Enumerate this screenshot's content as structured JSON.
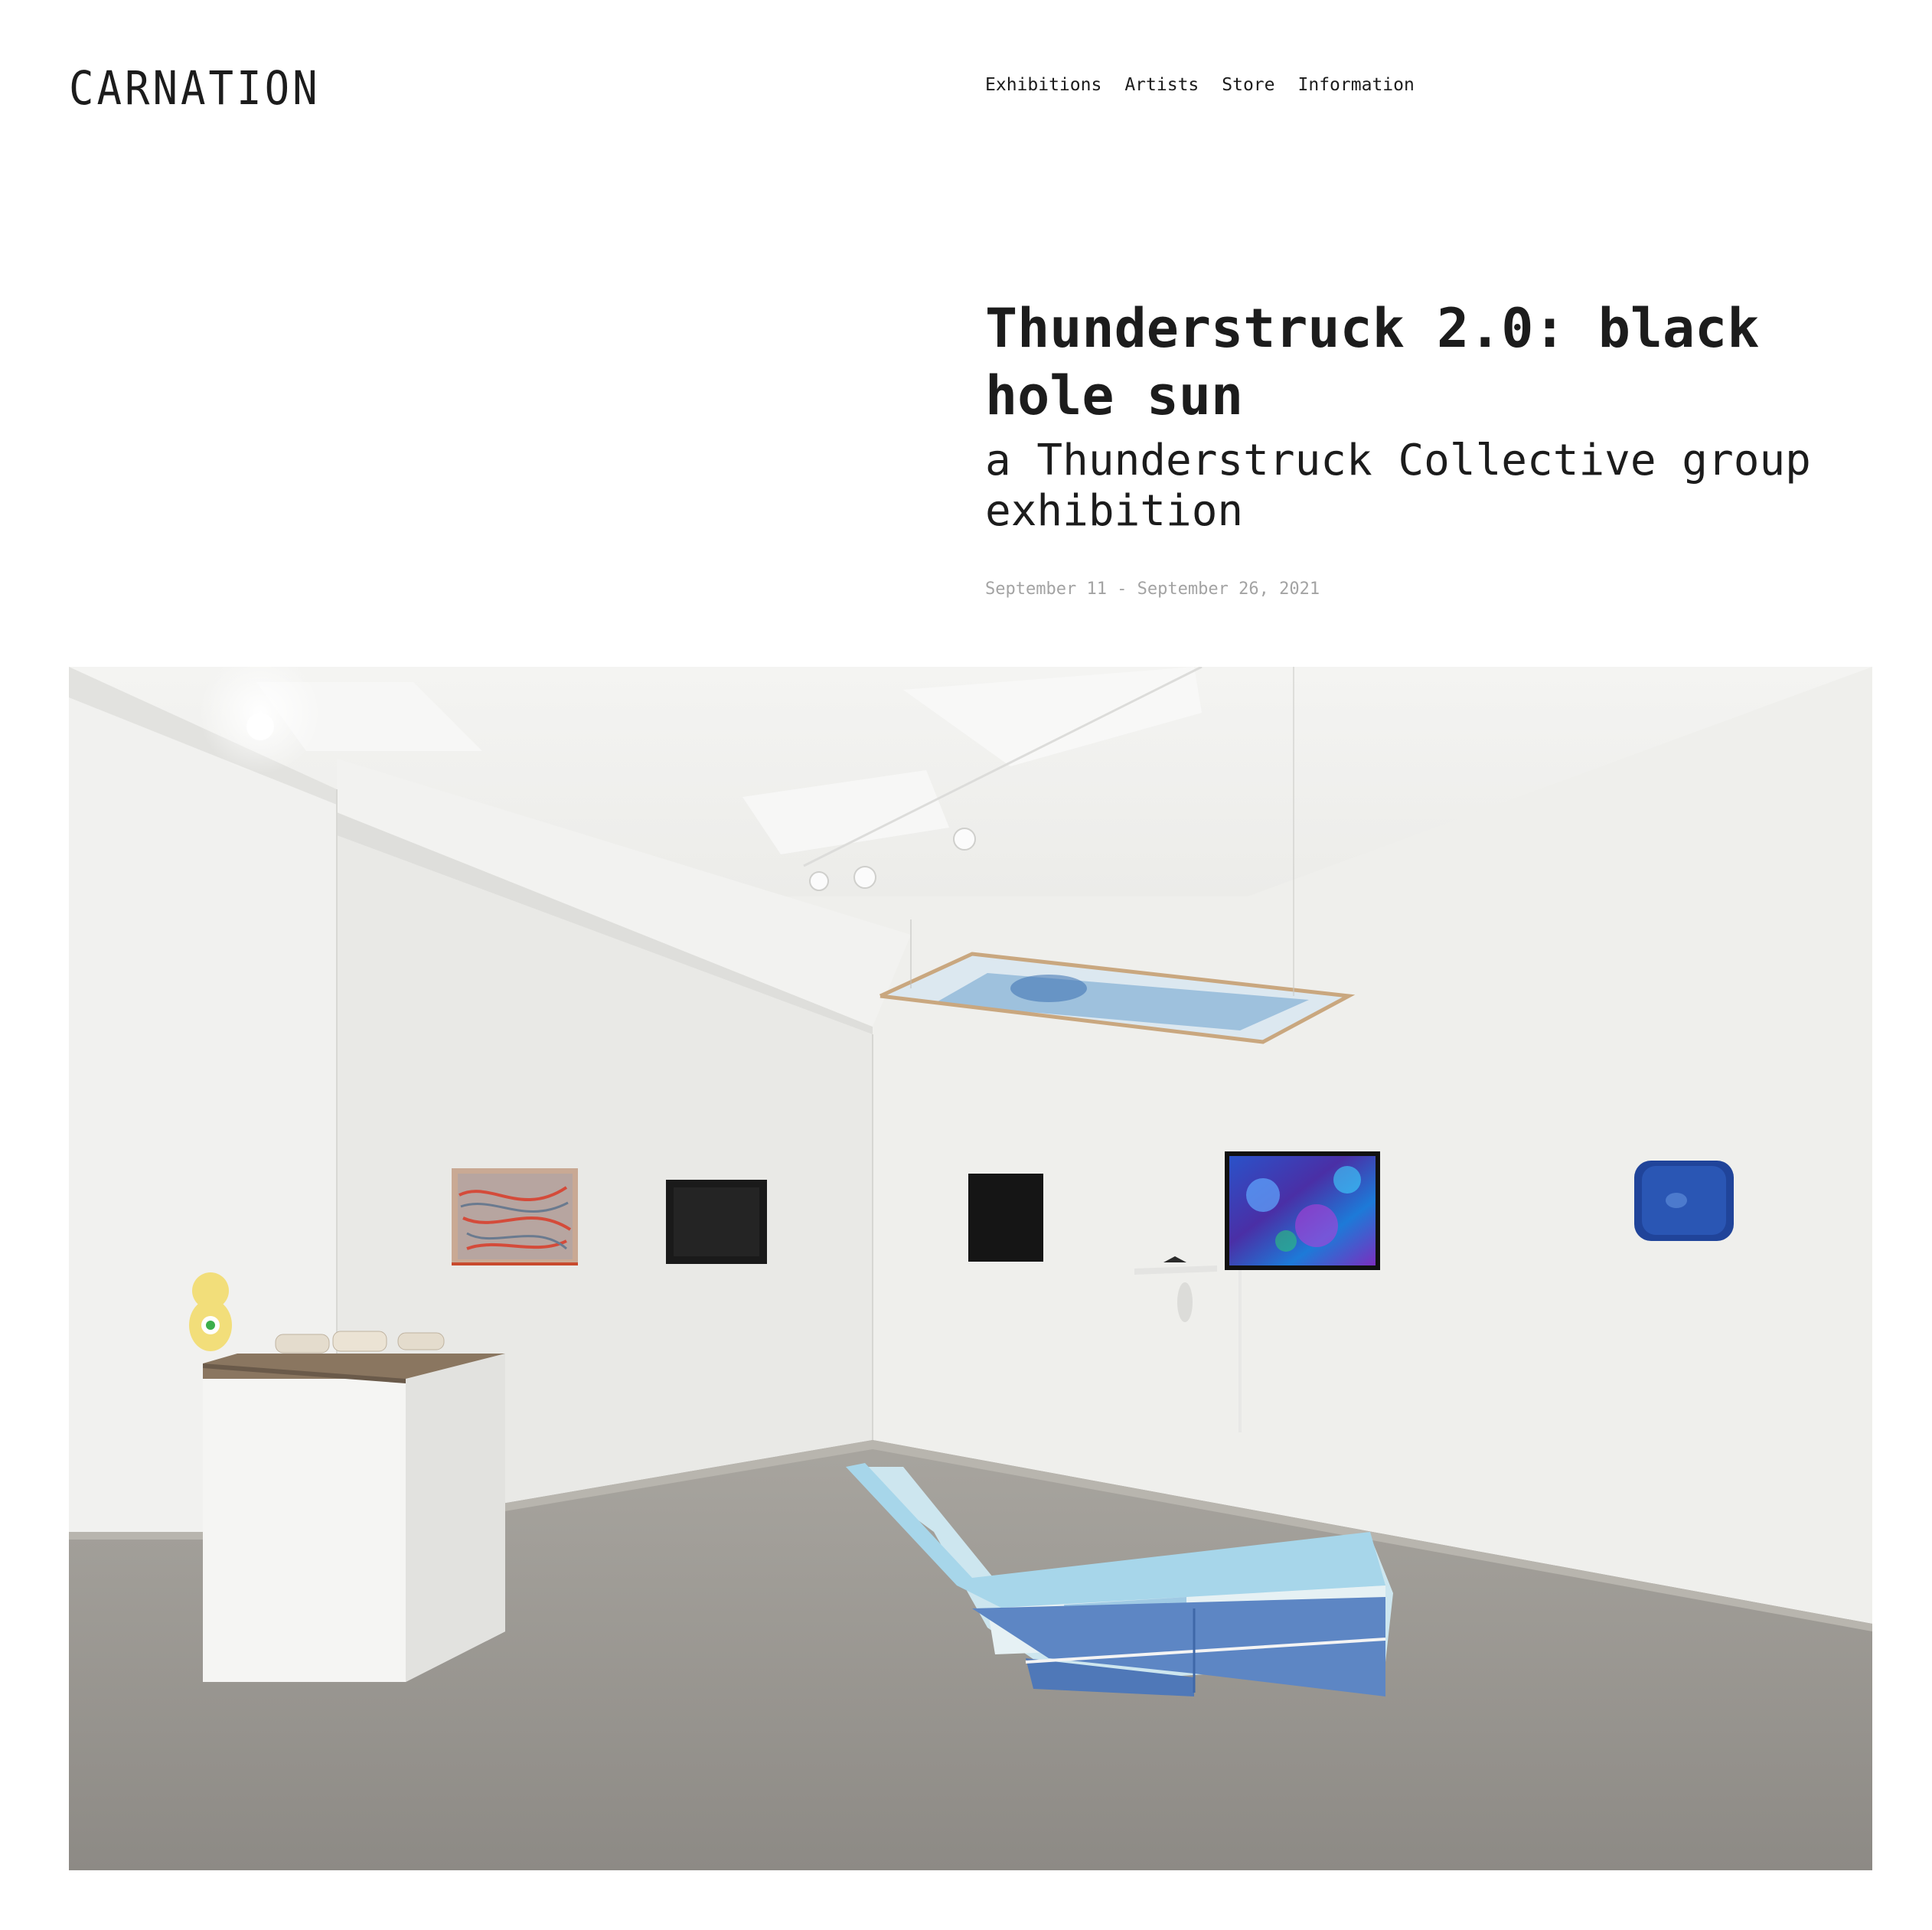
{
  "header": {
    "logo": "CARNATION",
    "nav": [
      "Exhibitions",
      "Artists",
      "Store",
      "Information"
    ]
  },
  "exhibition": {
    "title": "Thunderstruck 2.0: black hole sun",
    "subtitle": "a Thunderstruck Collective group exhibition",
    "dates": "September 11 - September 26, 2021"
  },
  "colors": {
    "text": "#1c1c1c",
    "muted": "#a3a3a3",
    "background": "#ffffff"
  }
}
